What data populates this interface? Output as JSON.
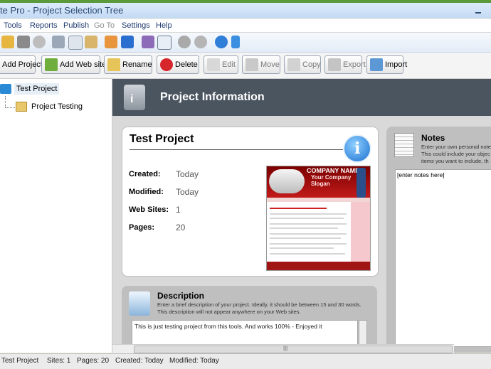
{
  "window": {
    "title": "te Pro - Project Selection Tree"
  },
  "menu": [
    "Tools",
    "Reports",
    "Publish",
    "Go To",
    "Settings",
    "Help"
  ],
  "toolbar_icons": [
    "open-icon",
    "save-icon",
    "cancel-icon",
    "cut-icon",
    "copy-icon",
    "paste-icon",
    "users-icon",
    "google-icon",
    "html-icon",
    "list-icon",
    "circle-icon",
    "circle2-icon",
    "help-icon",
    "phone-icon"
  ],
  "actions": {
    "add_project": "Add Project",
    "add_web_site": "Add Web site",
    "rename": "Rename",
    "delete": "Delete",
    "edit": "Edit",
    "move": "Move",
    "copy": "Copy",
    "export": "Export",
    "import": "Import"
  },
  "tree": {
    "root": "Test Project",
    "child": "Project Testing"
  },
  "header": {
    "title": "Project Information"
  },
  "project": {
    "name": "Test Project",
    "created_label": "Created:",
    "created": "Today",
    "modified_label": "Modified:",
    "modified": "Today",
    "websites_label": "Web Sites:",
    "websites": "1",
    "pages_label": "Pages:",
    "pages": "20",
    "thumb_company": "COMPANY NAME",
    "thumb_slogan": "Your Company Slogan"
  },
  "description": {
    "title": "Description",
    "help": "Enter a brief description of your project. Ideally, it should be between 15 and 30 words. This description will not appear anywhere on your Web sites.",
    "text": "This is just testing project from this tools. And works 100% - Enjoyed it"
  },
  "notes": {
    "title": "Notes",
    "help1": "Enter your own personal notes",
    "help2": "This could include your objec",
    "help3": "items you want to include, th",
    "placeholder": "[enter notes here]"
  },
  "status": {
    "project": "Test Project",
    "sites": "Sites: 1",
    "pages": "Pages: 20",
    "created": "Created: Today",
    "modified": "Modified: Today"
  },
  "colors": {
    "header_bg": "#4b5560",
    "accent_blue": "#1a6fd0",
    "panel_bg": "#d9d9d9"
  }
}
